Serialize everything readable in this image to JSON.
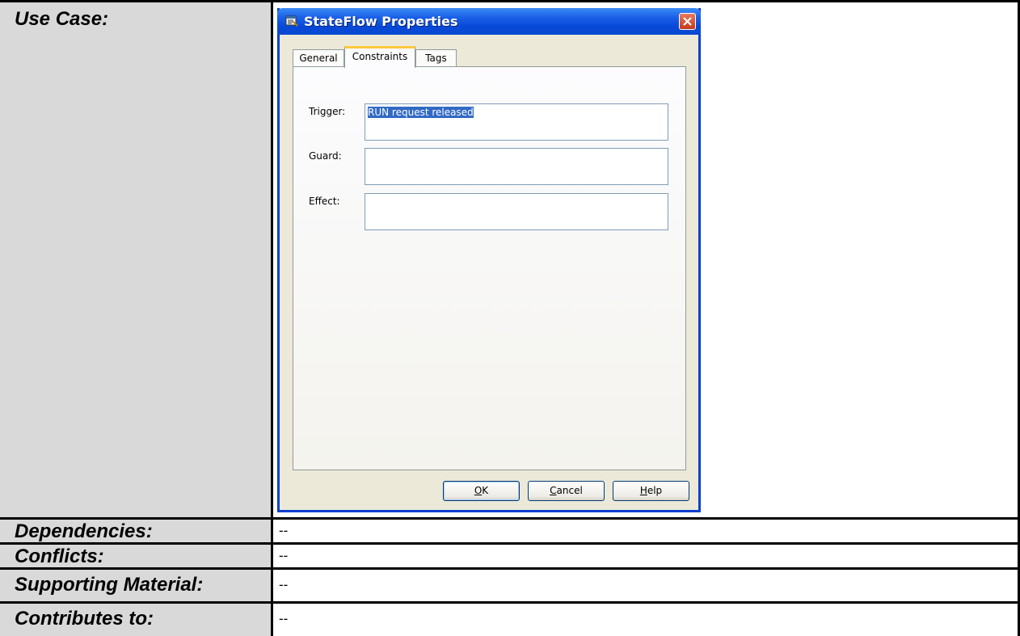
{
  "table": {
    "rows": [
      {
        "label": "Use Case:",
        "value": ""
      },
      {
        "label": "Dependencies:",
        "value": "--"
      },
      {
        "label": "Conflicts:",
        "value": "--"
      },
      {
        "label": "Supporting Material:",
        "value": "--"
      },
      {
        "label": "Contributes to:",
        "value": "--"
      }
    ]
  },
  "dialog": {
    "title": "StateFlow Properties",
    "title_icon": "properties-icon",
    "tabs": [
      {
        "label": "General",
        "active": false
      },
      {
        "label": "Constraints",
        "active": true
      },
      {
        "label": "Tags",
        "active": false
      }
    ],
    "fields": {
      "trigger": {
        "label": "Trigger:",
        "value": "RUN request released"
      },
      "guard": {
        "label": "Guard:",
        "value": ""
      },
      "effect": {
        "label": "Effect:",
        "value": ""
      }
    },
    "buttons": {
      "ok_hotkey": "O",
      "ok_rest": "K",
      "cancel_hotkey": "C",
      "cancel_rest": "ancel",
      "help_hotkey": "H",
      "help_rest": "elp"
    },
    "colors": {
      "title_bar": "#0a4ad0",
      "close_button": "#c43a1c",
      "active_tab_accent": "#ffc83c",
      "selection": "#316ac5"
    }
  }
}
